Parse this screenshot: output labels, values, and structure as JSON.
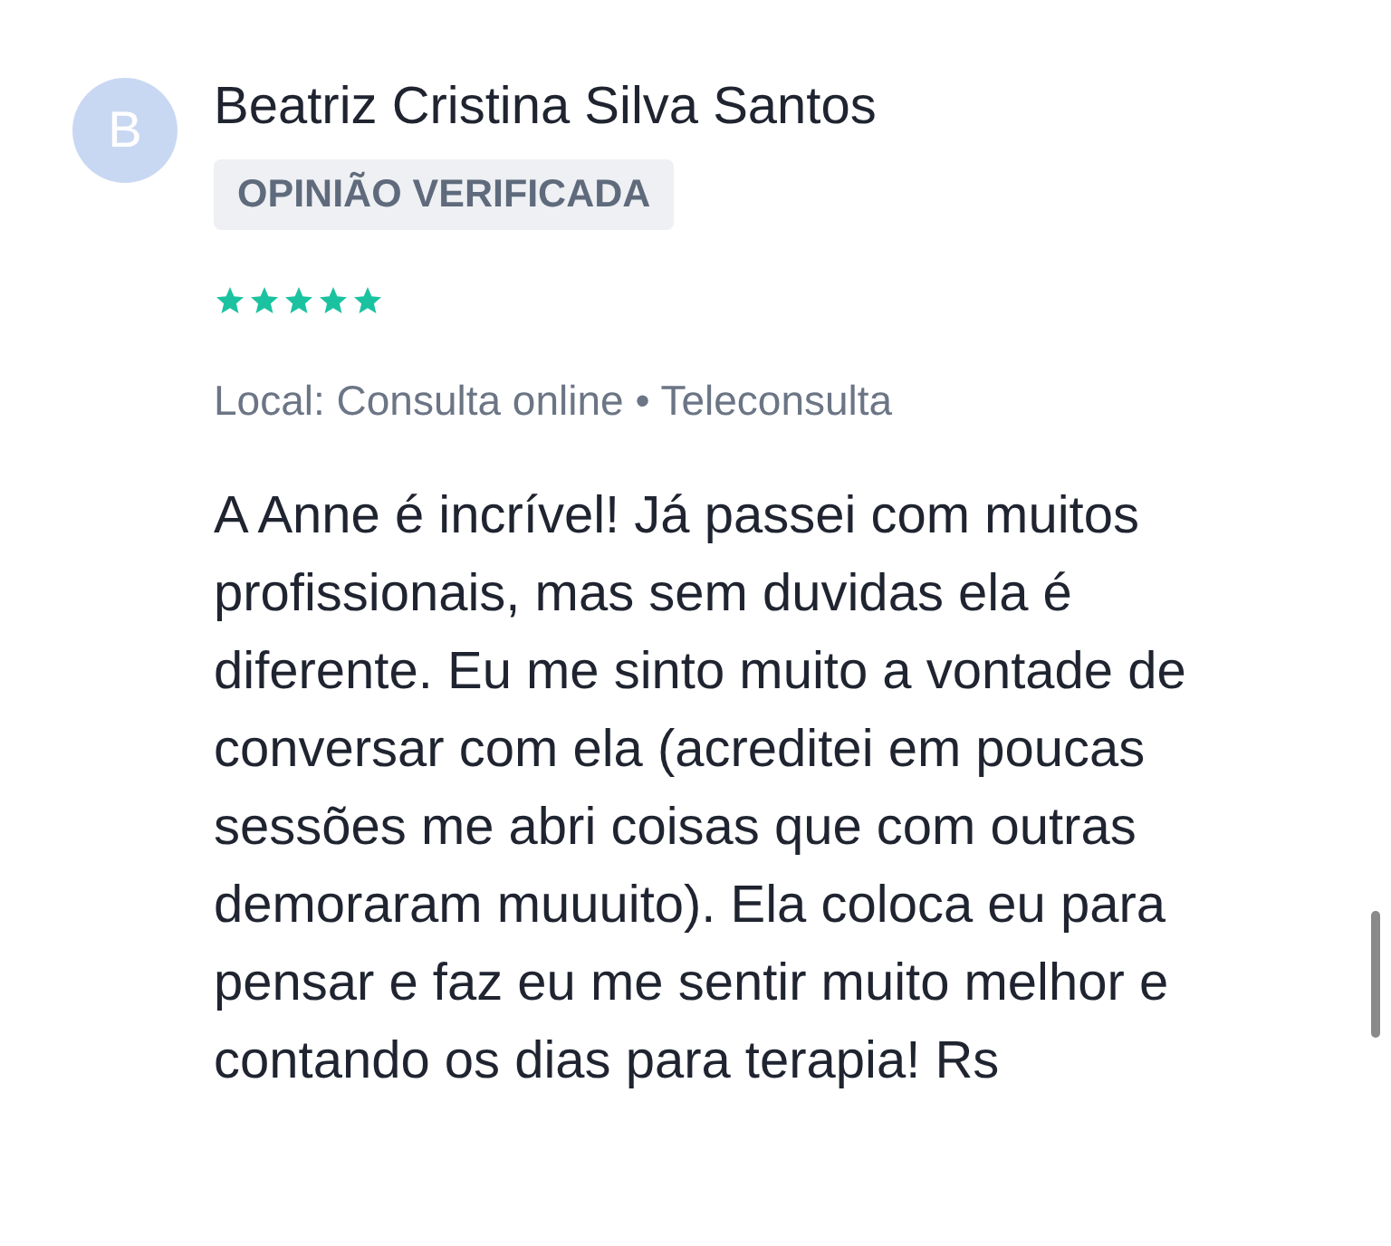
{
  "review": {
    "avatar_initial": "B",
    "author": "Beatriz Cristina Silva Santos",
    "badge": "OPINIÃO VERIFICADA",
    "stars": 5,
    "location": "Local: Consulta online • Teleconsulta",
    "text": "A Anne é incrível! Já passei com muitos profissionais, mas sem duvidas ela é diferente. Eu me sinto muito a vontade de conversar com ela (acreditei em poucas sessões me abri coisas que com outras demoraram muuuito). Ela coloca eu para pensar e faz eu me sentir muito melhor e contando os dias para terapia! Rs"
  }
}
